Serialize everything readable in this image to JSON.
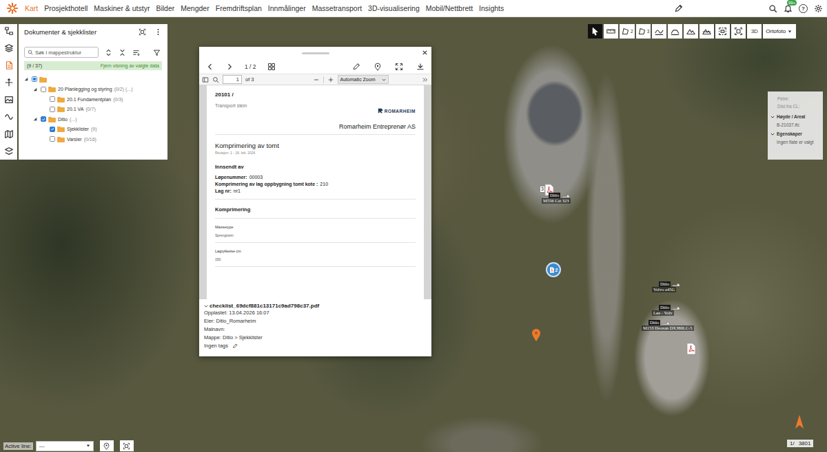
{
  "nav": {
    "items": [
      {
        "label": "Kart",
        "selected": true
      },
      {
        "label": "Prosjekthotell",
        "selected": false
      },
      {
        "label": "Maskiner & utstyr",
        "selected": false
      },
      {
        "label": "Bilder",
        "selected": false
      },
      {
        "label": "Mengder",
        "selected": false
      },
      {
        "label": "Fremdriftsplan",
        "selected": false
      },
      {
        "label": "Innmålinger",
        "selected": false
      },
      {
        "label": "Massetransport",
        "selected": false
      },
      {
        "label": "3D-visualisering",
        "selected": false
      },
      {
        "label": "Mobil/Nettbrett",
        "selected": false
      },
      {
        "label": "Insights",
        "selected": false
      }
    ],
    "notification_badge": "99+",
    "help_glyph": "?"
  },
  "side_toolbar": {
    "tools": [
      {
        "kind": "hierarchy",
        "selected": false
      },
      {
        "kind": "layers",
        "selected": false
      },
      {
        "kind": "document",
        "selected": true
      },
      {
        "kind": "axis",
        "selected": false
      },
      {
        "kind": "gallery",
        "selected": false
      },
      {
        "kind": "signal",
        "selected": false
      },
      {
        "kind": "map",
        "selected": false
      },
      {
        "kind": "stack",
        "selected": false
      }
    ]
  },
  "documents_panel": {
    "title": "Dokumenter & sjekklister",
    "search_placeholder": "Søk i mappestruktur",
    "selection_count": "(9 / 37)",
    "clear_link": "Fjern visning av valgte data",
    "tree": [
      {
        "label": "",
        "counts": "",
        "checked": false,
        "indeterminate": true,
        "expanded": true,
        "children": [
          {
            "label": "20 Planlegging og styring",
            "counts": "(0/2) (...)",
            "checked": false,
            "indeterminate": false,
            "expanded": true,
            "children": [
              {
                "label": "20.1 Fundamentplan",
                "counts": "(0/3)",
                "checked": false,
                "indeterminate": false,
                "expanded": false,
                "children": []
              },
              {
                "label": "20.1 VA",
                "counts": "(0/7)",
                "checked": false,
                "indeterminate": false,
                "expanded": false,
                "children": []
              }
            ]
          },
          {
            "label": "Ditio",
            "counts": "(...)",
            "checked": true,
            "indeterminate": false,
            "expanded": true,
            "children": [
              {
                "label": "Sjekklister",
                "counts": "(9)",
                "checked": true,
                "indeterminate": false,
                "expanded": false,
                "children": []
              },
              {
                "label": "Varsler",
                "counts": "(0/16)",
                "checked": false,
                "indeterminate": false,
                "expanded": false,
                "children": []
              }
            ]
          }
        ]
      }
    ]
  },
  "viewer": {
    "pager": "1 / 2",
    "pdf_toolbar": {
      "page": "1",
      "page_total": "of 3",
      "zoom": "Automatic Zoom"
    },
    "page": {
      "project": "20101 /",
      "subtitle": "Transport stein",
      "logo": "ROMARHEIM",
      "company": "Romarheim Entreprenør AS",
      "title": "Komprimering av tomt",
      "revision": "Revisjon: 1 - 18. feb. 2026",
      "submitted_heading": "Innsendt av",
      "fields": [
        {
          "label": "Løpenummer:",
          "value": "00003"
        },
        {
          "label": "Komprimering av lag oppbygning tomt kote :",
          "value": "210"
        },
        {
          "label": "Lag nr:",
          "value": "nr1"
        }
      ],
      "section": "Komprimering",
      "rows": [
        {
          "label": "Massetype",
          "value": "Sprengstein"
        },
        {
          "label": "Lagtykkelse cm",
          "value": "150"
        }
      ]
    },
    "file": {
      "name": "checklist_69dcf881c13171c9ad798c37.pdf",
      "expanded": true,
      "details": [
        "Opplastet: 13.04.2026 16:07",
        "Eier: Ditio_Romarheim",
        "Malnavn:",
        "Mappe: Ditio > Sjekklister"
      ],
      "tags": "Ingen tags"
    }
  },
  "map_toolbar": {
    "tools": [
      {
        "kind": "pointer",
        "selected": true
      },
      {
        "kind": "ruler",
        "selected": false
      },
      {
        "kind": "polygon",
        "badge": "2",
        "selected": false
      },
      {
        "kind": "polygon",
        "badge": "3",
        "selected": false
      },
      {
        "kind": "profile",
        "selected": false
      },
      {
        "kind": "crosssection",
        "selected": false
      },
      {
        "kind": "terrain",
        "selected": false
      },
      {
        "kind": "volume",
        "selected": false
      },
      {
        "kind": "select",
        "selected": false
      },
      {
        "kind": "fit",
        "selected": false
      },
      {
        "kind": "text",
        "label": "3D",
        "selected": false
      }
    ],
    "basemap": "Ortofoto"
  },
  "info_box": {
    "fields": [
      "Pelnr:",
      "Dist.fra CL:"
    ],
    "sections": [
      {
        "title": "Høyde / Areal",
        "value": "B-21037.ifc",
        "expanded": true
      },
      {
        "title": "Egenskaper",
        "value": "Ingen flate er valgt",
        "expanded": true
      }
    ]
  },
  "map": {
    "markers": [
      {
        "kind": "pdf",
        "count": "3"
      },
      {
        "kind": "cluster",
        "count": "2"
      },
      {
        "kind": "pdf"
      },
      {
        "kind": "pin"
      }
    ],
    "machines": [
      {
        "owner": "Ditio",
        "name": "M556 Cat 323"
      },
      {
        "owner": "Ditio",
        "name": "Volvo a45G"
      },
      {
        "owner": "Ditio",
        "name": "Løe - Volv"
      },
      {
        "owner": "Ditio",
        "name": "M153 Doosan DX380LC-5"
      }
    ]
  },
  "bottom": {
    "active_line": {
      "label": "Active line:",
      "value": "---"
    },
    "scale": {
      "prefix": "1/",
      "value": "3801"
    }
  }
}
